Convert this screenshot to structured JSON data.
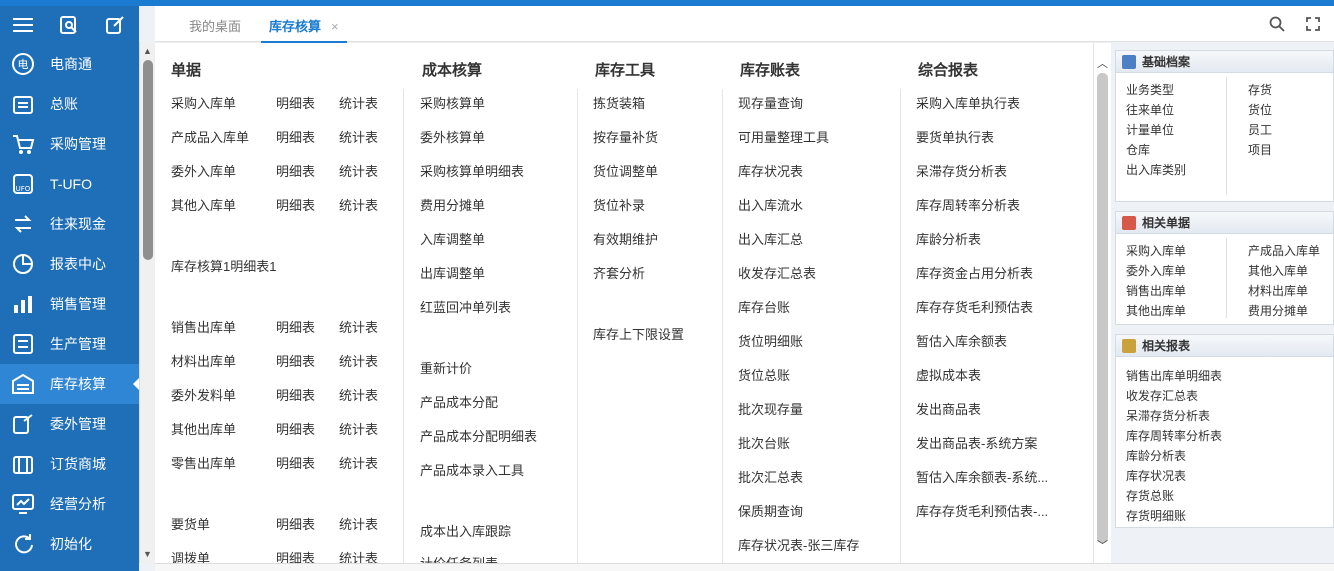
{
  "sidebar": {
    "items": [
      {
        "label": "电商通",
        "icon": "ecommerce-icon"
      },
      {
        "label": "总账",
        "icon": "ledger-icon"
      },
      {
        "label": "采购管理",
        "icon": "cart-icon"
      },
      {
        "label": "T-UFO",
        "icon": "ufo-icon"
      },
      {
        "label": "往来现金",
        "icon": "transfer-icon"
      },
      {
        "label": "报表中心",
        "icon": "pie-chart-icon"
      },
      {
        "label": "销售管理",
        "icon": "bar-chart-icon"
      },
      {
        "label": "生产管理",
        "icon": "production-icon"
      },
      {
        "label": "库存核算",
        "icon": "inventory-icon"
      },
      {
        "label": "委外管理",
        "icon": "outsource-icon"
      },
      {
        "label": "订货商城",
        "icon": "mall-icon"
      },
      {
        "label": "经营分析",
        "icon": "analysis-icon"
      },
      {
        "label": "初始化",
        "icon": "init-icon"
      }
    ]
  },
  "tabs": {
    "desktop": "我的桌面",
    "active": "库存核算",
    "close": "×"
  },
  "menu": {
    "danju": {
      "title": "单据",
      "rows": [
        [
          "采购入库单",
          "明细表",
          "统计表"
        ],
        [
          "产成品入库单",
          "明细表",
          "统计表"
        ],
        [
          "委外入库单",
          "明细表",
          "统计表"
        ],
        [
          "其他入库单",
          "明细表",
          "统计表"
        ],
        [
          "库存核算1明细表1"
        ],
        [
          "销售出库单",
          "明细表",
          "统计表"
        ],
        [
          "材料出库单",
          "明细表",
          "统计表"
        ],
        [
          "委外发料单",
          "明细表",
          "统计表"
        ],
        [
          "其他出库单",
          "明细表",
          "统计表"
        ],
        [
          "零售出库单",
          "明细表",
          "统计表"
        ],
        [
          "要货单",
          "明细表",
          "统计表"
        ],
        [
          "调拨单",
          "明细表",
          "统计表"
        ]
      ]
    },
    "chengben": {
      "title": "成本核算",
      "items": [
        "采购核算单",
        "委外核算单",
        "采购核算单明细表",
        "费用分摊单",
        "入库调整单",
        "出库调整单",
        "红蓝回冲单列表",
        "重新计价",
        "产品成本分配",
        "产品成本分配明细表",
        "产品成本录入工具",
        "成本出入库跟踪",
        "计价任务列表"
      ]
    },
    "gongju": {
      "title": "库存工具",
      "items": [
        "拣货装箱",
        "按存量补货",
        "货位调整单",
        "货位补录",
        "有效期维护",
        "齐套分析",
        "库存上下限设置"
      ]
    },
    "zhangbiao": {
      "title": "库存账表",
      "items": [
        "现存量查询",
        "可用量整理工具",
        "库存状况表",
        "出入库流水",
        "出入库汇总",
        "收发存汇总表",
        "库存台账",
        "货位明细账",
        "货位总账",
        "批次现存量",
        "批次台账",
        "批次汇总表",
        "保质期查询",
        "库存状况表-张三库存"
      ]
    },
    "zonghe": {
      "title": "综合报表",
      "items": [
        "采购入库单执行表",
        "要货单执行表",
        "呆滞存货分析表",
        "库存周转率分析表",
        "库龄分析表",
        "库存资金占用分析表",
        "库存存货毛利预估表",
        "暂估入库余额表",
        "虚拟成本表",
        "发出商品表",
        "发出商品表-系统方案",
        "暂估入库余额表-系统...",
        "库存存货毛利预估表-..."
      ]
    }
  },
  "right": {
    "basic": {
      "title": "基础档案",
      "left": [
        "业务类型",
        "往来单位",
        "计量单位",
        "仓库",
        "出入库类别"
      ],
      "right": [
        "存货",
        "货位",
        "员工",
        "项目"
      ]
    },
    "docs": {
      "title": "相关单据",
      "left": [
        "采购入库单",
        "委外入库单",
        "销售出库单",
        "其他出库单"
      ],
      "right": [
        "产成品入库单",
        "其他入库单",
        "材料出库单",
        "费用分摊单"
      ]
    },
    "reports": {
      "title": "相关报表",
      "items": [
        "销售出库单明细表",
        "收发存汇总表",
        "呆滞存货分析表",
        "库存周转率分析表",
        "库龄分析表",
        "库存状况表",
        "存货总账",
        "存货明细账"
      ]
    }
  },
  "colors": {
    "sidebar": "#1f6fb8",
    "active": "#2f86d4",
    "accent": "#1a7bd1"
  }
}
